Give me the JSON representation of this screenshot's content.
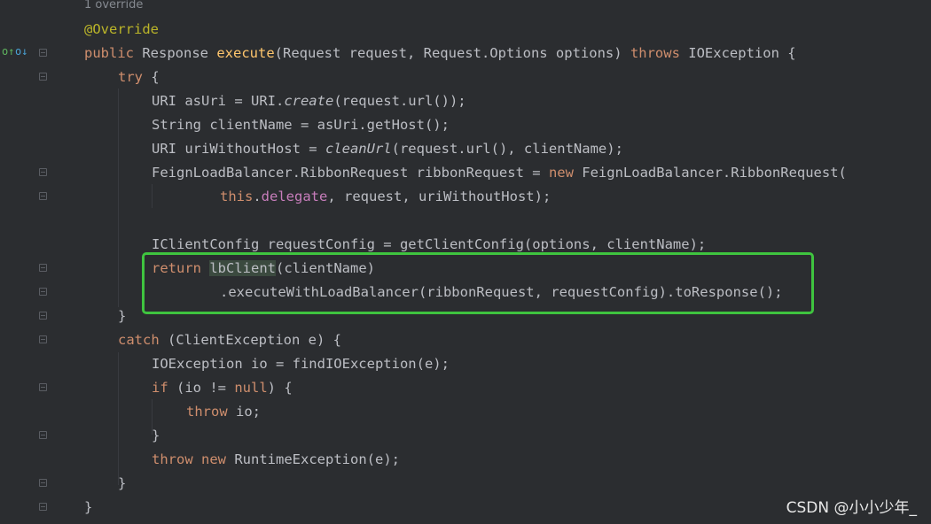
{
  "editor": {
    "usage_hint": "1 override",
    "lines": {
      "l1": {
        "a": "@Override"
      },
      "l2": {
        "a": "public",
        "b": " Response ",
        "c": "execute",
        "d": "(Request request, Request.Options options) ",
        "e": "throws",
        "f": " IOException {"
      },
      "l3": {
        "a": "try",
        "b": " {"
      },
      "l4": {
        "a": "URI asUri = URI.",
        "b": "create",
        "c": "(request.url());"
      },
      "l5": {
        "a": "String clientName = asUri.getHost();"
      },
      "l6": {
        "a": "URI uriWithoutHost = ",
        "b": "cleanUrl",
        "c": "(request.url(), clientName);"
      },
      "l7": {
        "a": "FeignLoadBalancer.RibbonRequest ribbonRequest = ",
        "b": "new",
        "c": " FeignLoadBalancer.RibbonRequest("
      },
      "l8": {
        "a": "this",
        "b": ".",
        "c": "delegate",
        "d": ", request, uriWithoutHost);"
      },
      "l9": {
        "a": "IClientConfig requestConfig = getClientConfig(options, clientName);"
      },
      "l10": {
        "a": "return",
        "b": " ",
        "c": "lbClient",
        "d": "(clientName)"
      },
      "l11": {
        "a": ".executeWithLoadBalancer(ribbonRequest, requestConfig).toResponse();"
      },
      "l12": {
        "a": "}"
      },
      "l13": {
        "a": "catch",
        "b": " (ClientException e) {"
      },
      "l14": {
        "a": "IOException io = findIOException(e);"
      },
      "l15": {
        "a": "if",
        "b": " (io != ",
        "c": "null",
        "d": ") {"
      },
      "l16": {
        "a": "throw",
        "b": " io;"
      },
      "l17": {
        "a": "}"
      },
      "l18": {
        "a": "throw",
        "b": " ",
        "c": "new",
        "d": " RuntimeException(e);"
      },
      "l19": {
        "a": "}"
      },
      "l20": {
        "a": "}"
      }
    }
  },
  "gutter_icons": {
    "override_icon": "override-implemented-icon",
    "implemented_icon": "implementation-icon"
  },
  "watermark": "CSDN @小小少年_",
  "colors": {
    "background": "#2b2d30",
    "keyword": "#cf8e6d",
    "text": "#bcbec4",
    "annotation": "#bbb529",
    "field": "#c77dbb",
    "highlight_border": "#3fc43f"
  }
}
